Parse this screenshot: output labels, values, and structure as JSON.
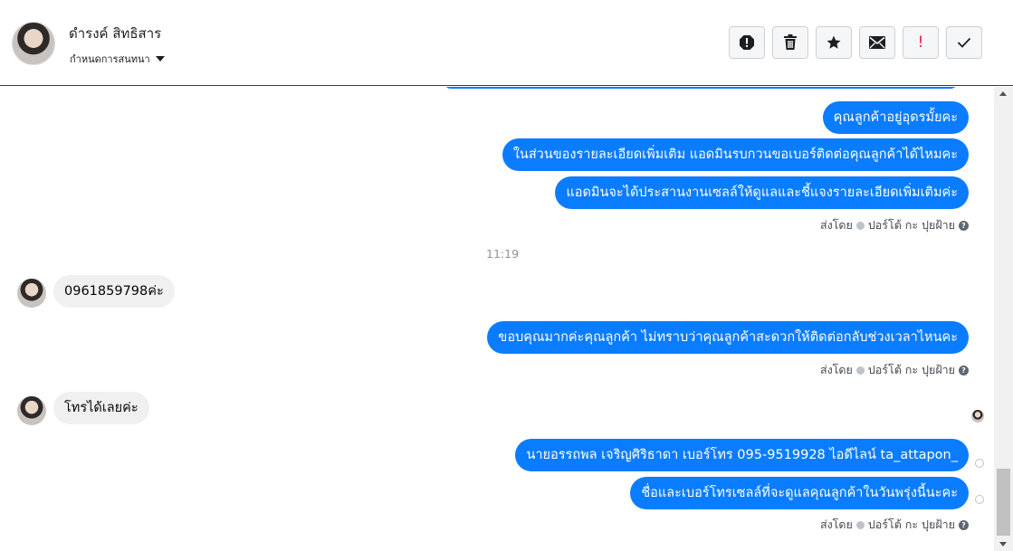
{
  "header": {
    "contact_name": "ดำรงค์ สิทธิสาร",
    "assign_label": "กำหนดการสนทนา"
  },
  "toolbar": {
    "items": [
      "report-spam",
      "delete",
      "star",
      "mark-unread",
      "important",
      "done"
    ],
    "important_label": "!"
  },
  "conversation": {
    "messages": [
      {
        "dir": "out",
        "text": "คุณลูกค้าอยู่อุดรมั้ยคะ"
      },
      {
        "dir": "out",
        "text": "ในส่วนของรายละเอียดเพิ่มเติม แอดมินรบกวนขอเบอร์ติดต่อคุณลูกค้าได้ไหมคะ"
      },
      {
        "dir": "out",
        "text": "แอดมินจะได้ประสานงานเซลล์ให้ดูแลและชี้แจงรายละเอียดเพิ่มเติมค่ะ"
      },
      {
        "dir": "in",
        "text": "0961859798ค่ะ"
      },
      {
        "dir": "out",
        "text": "ขอบคุณมากค่ะคุณลูกค้า ไม่ทราบว่าคุณลูกค้าสะดวกให้ติดต่อกลับช่วงเวลาไหนคะ"
      },
      {
        "dir": "in",
        "text": "โทรได้เลยค่ะ"
      },
      {
        "dir": "out",
        "text": "นายอรรถพล เจริญศิริธาดา     เบอร์โทร 095-9519928 ไอดีไลน์ ta_attapon_"
      },
      {
        "dir": "out",
        "text": "ชื่อและเบอร์โทรเซลล์ที่จะดูแลคุณลูกค้าในวันพรุ่งนี้นะคะ"
      }
    ],
    "timestamp": "11:19",
    "sent_by_prefix": "ส่งโดย",
    "sent_by_name": "ปอร์โต้ กะ ปุยฝ้าย"
  }
}
